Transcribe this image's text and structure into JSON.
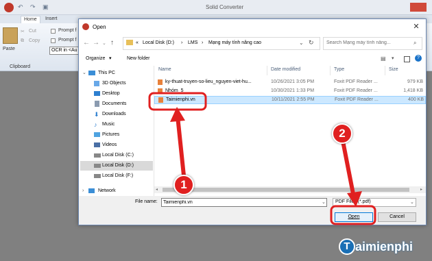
{
  "app": {
    "title": "Solid Converter",
    "tabs": [
      "Home",
      "Insert"
    ],
    "ribbon": {
      "paste_label": "Paste",
      "cut_label": "Cut",
      "copy_label": "Copy",
      "clipboard_label": "Clipboard",
      "prompt_1": "Prompt f",
      "prompt_2": "Prompt f",
      "ocr_label": "OCR in <Au"
    }
  },
  "dialog": {
    "title": "Open",
    "close_glyph": "✕",
    "breadcrumb": [
      "Local Disk (D:)",
      "LMS",
      "Mạng máy tính nâng cao"
    ],
    "breadcrumb_sep": "›",
    "breadcrumb_overflow": "«",
    "search_placeholder": "Search Mạng máy tính nâng...",
    "organize_label": "Organize",
    "new_folder_label": "New folder",
    "sidebar": [
      {
        "label": "This PC",
        "icon": "pc-icon",
        "selected": false
      },
      {
        "label": "3D Objects",
        "icon": "cube-icon",
        "selected": false
      },
      {
        "label": "Desktop",
        "icon": "desktop-icon",
        "selected": false
      },
      {
        "label": "Documents",
        "icon": "documents-icon",
        "selected": false
      },
      {
        "label": "Downloads",
        "icon": "download-icon",
        "selected": false
      },
      {
        "label": "Music",
        "icon": "music-icon",
        "selected": false
      },
      {
        "label": "Pictures",
        "icon": "pictures-icon",
        "selected": false
      },
      {
        "label": "Videos",
        "icon": "videos-icon",
        "selected": false
      },
      {
        "label": "Local Disk (C:)",
        "icon": "drive-icon",
        "selected": false
      },
      {
        "label": "Local Disk (D:)",
        "icon": "drive-icon",
        "selected": true
      },
      {
        "label": "Local Disk (F:)",
        "icon": "drive-icon",
        "selected": false
      },
      {
        "label": "Network",
        "icon": "network-icon",
        "selected": false
      }
    ],
    "columns": {
      "name": "Name",
      "date": "Date modified",
      "type": "Type",
      "size": "Size"
    },
    "files": [
      {
        "name": "ky-thuat-truyen-so-lieu_nguyen-viet-hu...",
        "date": "10/26/2021 3:05 PM",
        "type": "Foxit PDF Reader ...",
        "size": "979 KB",
        "selected": false
      },
      {
        "name": "Nhóm_5",
        "date": "10/30/2021 1:33 PM",
        "type": "Foxit PDF Reader ...",
        "size": "1,418 KB",
        "selected": false
      },
      {
        "name": "Taimienphi.vn",
        "date": "10/11/2021 2:55 PM",
        "type": "Foxit PDF Reader ...",
        "size": "400 KB",
        "selected": true
      }
    ],
    "file_name_label": "File name:",
    "file_name_value": "Taimienphi.vn",
    "filter_value": "PDF Files (*.pdf)",
    "open_label": "Open",
    "cancel_label": "Cancel"
  },
  "annotations": {
    "step1": "1",
    "step2": "2",
    "accent": "#e02020"
  },
  "watermark": {
    "text": "aimienphi",
    "logo_letter": "T"
  }
}
